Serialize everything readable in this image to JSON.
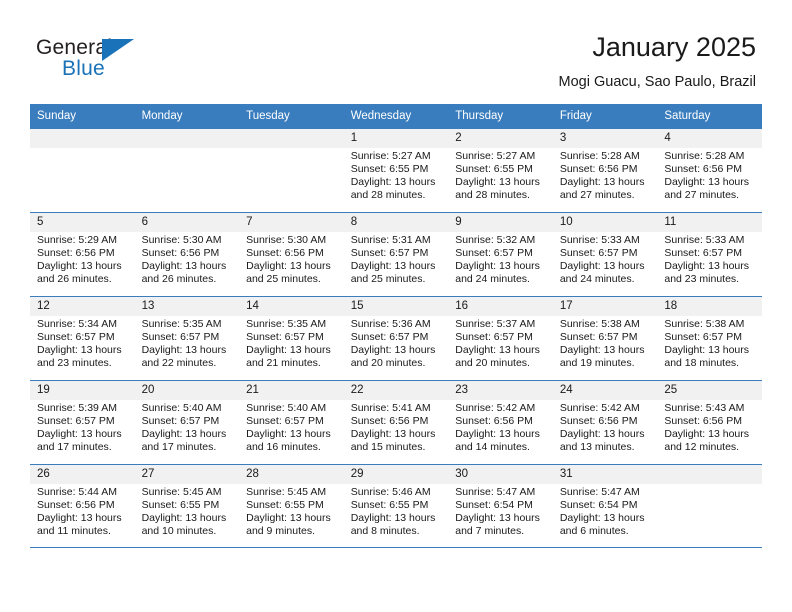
{
  "brand": {
    "word_one": "General",
    "word_two": "Blue",
    "flag_icon": "triangle-flag-icon"
  },
  "header": {
    "title": "January 2025",
    "subtitle": "Mogi Guacu, Sao Paulo, Brazil"
  },
  "colors": {
    "header_blue": "#3a7dbe",
    "brand_blue": "#1a72b8",
    "daynum_bg": "#f1f1f1",
    "text": "#1a1a1a"
  },
  "calendar": {
    "weekdays": [
      "Sunday",
      "Monday",
      "Tuesday",
      "Wednesday",
      "Thursday",
      "Friday",
      "Saturday"
    ],
    "weeks": [
      [
        {
          "day": "",
          "lines": []
        },
        {
          "day": "",
          "lines": []
        },
        {
          "day": "",
          "lines": []
        },
        {
          "day": "1",
          "lines": [
            "Sunrise: 5:27 AM",
            "Sunset: 6:55 PM",
            "Daylight: 13 hours",
            "and 28 minutes."
          ]
        },
        {
          "day": "2",
          "lines": [
            "Sunrise: 5:27 AM",
            "Sunset: 6:55 PM",
            "Daylight: 13 hours",
            "and 28 minutes."
          ]
        },
        {
          "day": "3",
          "lines": [
            "Sunrise: 5:28 AM",
            "Sunset: 6:56 PM",
            "Daylight: 13 hours",
            "and 27 minutes."
          ]
        },
        {
          "day": "4",
          "lines": [
            "Sunrise: 5:28 AM",
            "Sunset: 6:56 PM",
            "Daylight: 13 hours",
            "and 27 minutes."
          ]
        }
      ],
      [
        {
          "day": "5",
          "lines": [
            "Sunrise: 5:29 AM",
            "Sunset: 6:56 PM",
            "Daylight: 13 hours",
            "and 26 minutes."
          ]
        },
        {
          "day": "6",
          "lines": [
            "Sunrise: 5:30 AM",
            "Sunset: 6:56 PM",
            "Daylight: 13 hours",
            "and 26 minutes."
          ]
        },
        {
          "day": "7",
          "lines": [
            "Sunrise: 5:30 AM",
            "Sunset: 6:56 PM",
            "Daylight: 13 hours",
            "and 25 minutes."
          ]
        },
        {
          "day": "8",
          "lines": [
            "Sunrise: 5:31 AM",
            "Sunset: 6:57 PM",
            "Daylight: 13 hours",
            "and 25 minutes."
          ]
        },
        {
          "day": "9",
          "lines": [
            "Sunrise: 5:32 AM",
            "Sunset: 6:57 PM",
            "Daylight: 13 hours",
            "and 24 minutes."
          ]
        },
        {
          "day": "10",
          "lines": [
            "Sunrise: 5:33 AM",
            "Sunset: 6:57 PM",
            "Daylight: 13 hours",
            "and 24 minutes."
          ]
        },
        {
          "day": "11",
          "lines": [
            "Sunrise: 5:33 AM",
            "Sunset: 6:57 PM",
            "Daylight: 13 hours",
            "and 23 minutes."
          ]
        }
      ],
      [
        {
          "day": "12",
          "lines": [
            "Sunrise: 5:34 AM",
            "Sunset: 6:57 PM",
            "Daylight: 13 hours",
            "and 23 minutes."
          ]
        },
        {
          "day": "13",
          "lines": [
            "Sunrise: 5:35 AM",
            "Sunset: 6:57 PM",
            "Daylight: 13 hours",
            "and 22 minutes."
          ]
        },
        {
          "day": "14",
          "lines": [
            "Sunrise: 5:35 AM",
            "Sunset: 6:57 PM",
            "Daylight: 13 hours",
            "and 21 minutes."
          ]
        },
        {
          "day": "15",
          "lines": [
            "Sunrise: 5:36 AM",
            "Sunset: 6:57 PM",
            "Daylight: 13 hours",
            "and 20 minutes."
          ]
        },
        {
          "day": "16",
          "lines": [
            "Sunrise: 5:37 AM",
            "Sunset: 6:57 PM",
            "Daylight: 13 hours",
            "and 20 minutes."
          ]
        },
        {
          "day": "17",
          "lines": [
            "Sunrise: 5:38 AM",
            "Sunset: 6:57 PM",
            "Daylight: 13 hours",
            "and 19 minutes."
          ]
        },
        {
          "day": "18",
          "lines": [
            "Sunrise: 5:38 AM",
            "Sunset: 6:57 PM",
            "Daylight: 13 hours",
            "and 18 minutes."
          ]
        }
      ],
      [
        {
          "day": "19",
          "lines": [
            "Sunrise: 5:39 AM",
            "Sunset: 6:57 PM",
            "Daylight: 13 hours",
            "and 17 minutes."
          ]
        },
        {
          "day": "20",
          "lines": [
            "Sunrise: 5:40 AM",
            "Sunset: 6:57 PM",
            "Daylight: 13 hours",
            "and 17 minutes."
          ]
        },
        {
          "day": "21",
          "lines": [
            "Sunrise: 5:40 AM",
            "Sunset: 6:57 PM",
            "Daylight: 13 hours",
            "and 16 minutes."
          ]
        },
        {
          "day": "22",
          "lines": [
            "Sunrise: 5:41 AM",
            "Sunset: 6:56 PM",
            "Daylight: 13 hours",
            "and 15 minutes."
          ]
        },
        {
          "day": "23",
          "lines": [
            "Sunrise: 5:42 AM",
            "Sunset: 6:56 PM",
            "Daylight: 13 hours",
            "and 14 minutes."
          ]
        },
        {
          "day": "24",
          "lines": [
            "Sunrise: 5:42 AM",
            "Sunset: 6:56 PM",
            "Daylight: 13 hours",
            "and 13 minutes."
          ]
        },
        {
          "day": "25",
          "lines": [
            "Sunrise: 5:43 AM",
            "Sunset: 6:56 PM",
            "Daylight: 13 hours",
            "and 12 minutes."
          ]
        }
      ],
      [
        {
          "day": "26",
          "lines": [
            "Sunrise: 5:44 AM",
            "Sunset: 6:56 PM",
            "Daylight: 13 hours",
            "and 11 minutes."
          ]
        },
        {
          "day": "27",
          "lines": [
            "Sunrise: 5:45 AM",
            "Sunset: 6:55 PM",
            "Daylight: 13 hours",
            "and 10 minutes."
          ]
        },
        {
          "day": "28",
          "lines": [
            "Sunrise: 5:45 AM",
            "Sunset: 6:55 PM",
            "Daylight: 13 hours",
            "and 9 minutes."
          ]
        },
        {
          "day": "29",
          "lines": [
            "Sunrise: 5:46 AM",
            "Sunset: 6:55 PM",
            "Daylight: 13 hours",
            "and 8 minutes."
          ]
        },
        {
          "day": "30",
          "lines": [
            "Sunrise: 5:47 AM",
            "Sunset: 6:54 PM",
            "Daylight: 13 hours",
            "and 7 minutes."
          ]
        },
        {
          "day": "31",
          "lines": [
            "Sunrise: 5:47 AM",
            "Sunset: 6:54 PM",
            "Daylight: 13 hours",
            "and 6 minutes."
          ]
        },
        {
          "day": "",
          "lines": []
        }
      ]
    ]
  }
}
